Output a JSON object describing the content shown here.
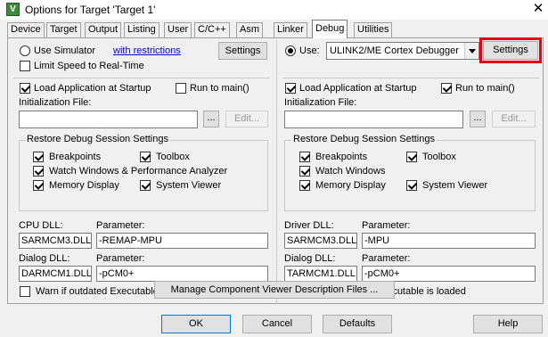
{
  "window": {
    "title": "Options for Target 'Target 1'",
    "close_glyph": "✕"
  },
  "tabs": [
    "Device",
    "Target",
    "Output",
    "Listing",
    "User",
    "C/C++",
    "Asm",
    "Linker",
    "Debug",
    "Utilities"
  ],
  "left": {
    "use_simulator": "Use Simulator",
    "restrictions_link": "with restrictions",
    "settings_button": "Settings",
    "limit_speed": "Limit Speed to Real-Time",
    "load_app": "Load Application at Startup",
    "run_to_main": "Run to main()",
    "init_file_label": "Initialization File:",
    "init_file_value": "",
    "browse": "...",
    "edit": "Edit...",
    "restore_title": "Restore Debug Session Settings",
    "breakpoints": "Breakpoints",
    "toolbox": "Toolbox",
    "watch_windows": "Watch Windows & Performance Analyzer",
    "memory_display": "Memory Display",
    "system_viewer": "System Viewer",
    "dll_label": "CPU DLL:",
    "param_label": "Parameter:",
    "dll_value": "SARMCM3.DLL",
    "dll_param": "-REMAP-MPU",
    "dialog_dll_label": "Dialog DLL:",
    "dialog_param_label": "Parameter:",
    "dialog_dll_value": "DARMCM1.DLL",
    "dialog_param_value": "-pCM0+",
    "warn_outdated": "Warn if outdated Executable is loaded"
  },
  "right": {
    "use_label": "Use:",
    "debugger_value": "ULINK2/ME Cortex Debugger",
    "settings_button": "Settings",
    "load_app": "Load Application at Startup",
    "run_to_main": "Run to main()",
    "init_file_label": "Initialization File:",
    "init_file_value": "",
    "browse": "...",
    "edit": "Edit...",
    "restore_title": "Restore Debug Session Settings",
    "breakpoints": "Breakpoints",
    "toolbox": "Toolbox",
    "watch_windows": "Watch Windows",
    "memory_display": "Memory Display",
    "system_viewer": "System Viewer",
    "dll_label": "Driver DLL:",
    "param_label": "Parameter:",
    "dll_value": "SARMCM3.DLL",
    "dll_param": "-MPU",
    "dialog_dll_label": "Dialog DLL:",
    "dialog_param_label": "Parameter:",
    "dialog_dll_value": "TARMCM1.DLL",
    "dialog_param_value": "-pCM0+",
    "warn_outdated": "Warn if outdated Executable is loaded"
  },
  "manage_button": "Manage Component Viewer Description Files ...",
  "footer": {
    "ok": "OK",
    "cancel": "Cancel",
    "defaults": "Defaults",
    "help": "Help"
  },
  "colors": {
    "highlight": "#e8000f",
    "link": "#0000cc",
    "dialog_bg": "#f0f0f0"
  },
  "icons": {
    "app": "keil-uvision-icon"
  }
}
